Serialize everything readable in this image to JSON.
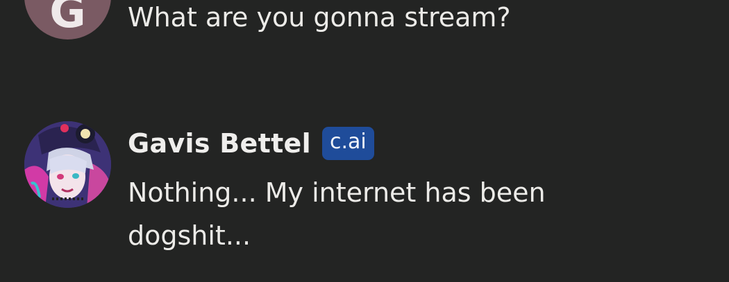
{
  "user_message": {
    "avatar_letter": "G",
    "avatar_color": "#7a5a63",
    "text": "What are you gonna stream?"
  },
  "character_message": {
    "name": "Gavis Bettel",
    "badge": "c.ai",
    "badge_color": "#1f4c9a",
    "avatar_icon": "character-portrait-avatar",
    "text_line1": "Nothing... My internet has been",
    "text_line2": "dogshit..."
  }
}
